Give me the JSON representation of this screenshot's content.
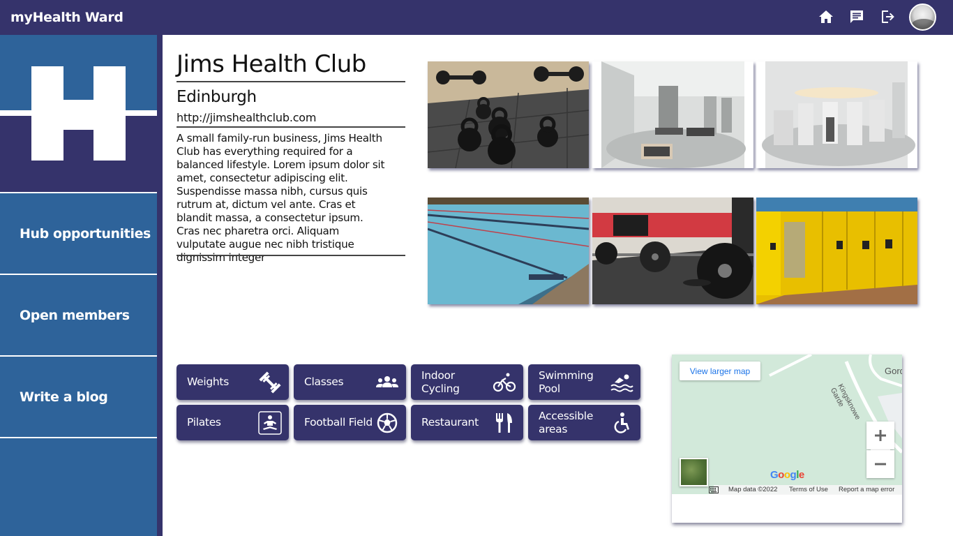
{
  "app": {
    "title": "myHealth Ward"
  },
  "topbar": {
    "icons": [
      "home-icon",
      "chat-icon",
      "logout-icon"
    ],
    "avatar": "user-avatar"
  },
  "sidebar": {
    "logo_letter": "H",
    "items": [
      {
        "label": "Hub opportunities"
      },
      {
        "label": "Open members"
      },
      {
        "label": "Write a blog"
      }
    ]
  },
  "club": {
    "name": "Jims Health Club",
    "city": "Edinburgh",
    "url": "http://jimshealthclub.com",
    "description": "A small family-run business, Jims Health Club has everything required for a balanced lifestyle. Lorem ipsum dolor sit amet, consectetur adipiscing elit. Suspendisse massa nibh, cursus quis rutrum at, dictum vel ante. Cras et blandit massa, a consectetur ipsum. Cras nec pharetra orci. Aliquam vulputate augue nec nibh tristique dignissim integer"
  },
  "gallery": [
    {
      "subject": "kettlebells"
    },
    {
      "subject": "gym-machines-room"
    },
    {
      "subject": "gym-machines-circle"
    },
    {
      "subject": "swimming-pool"
    },
    {
      "subject": "barbells"
    },
    {
      "subject": "yellow-lockers"
    }
  ],
  "facilities": [
    {
      "label": "Weights",
      "icon": "dumbbell-icon"
    },
    {
      "label": "Classes",
      "icon": "group-icon"
    },
    {
      "label": "Indoor Cycling",
      "icon": "bike-icon"
    },
    {
      "label": "Swimming Pool",
      "icon": "swimming-icon"
    },
    {
      "label": "Pilates",
      "icon": "pilates-icon"
    },
    {
      "label": "Football Field",
      "icon": "football-icon"
    },
    {
      "label": "Restaurant",
      "icon": "restaurant-icon"
    },
    {
      "label": "Accessible areas",
      "icon": "accessible-icon"
    }
  ],
  "map": {
    "view_larger": "View larger map",
    "zoom_in": "+",
    "zoom_out": "−",
    "street": "Kingsknowe Garde",
    "place": "Gordo",
    "brand": "Google",
    "data": "Map data ©2022",
    "terms": "Terms of Use",
    "report": "Report a map error",
    "colors": {
      "land": "#d2e9da",
      "road": "#ffffff"
    }
  },
  "colors": {
    "primary": "#35336b",
    "sidebar": "#2e639a"
  }
}
